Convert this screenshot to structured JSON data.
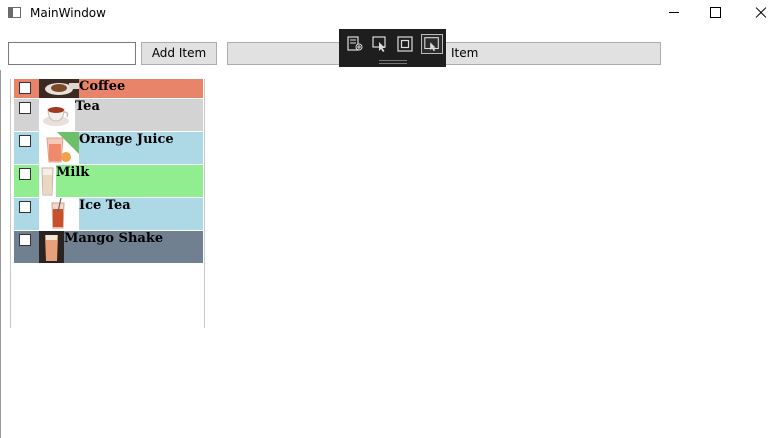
{
  "window": {
    "title": "MainWindow"
  },
  "toolbar": {
    "item_input_value": "",
    "add_label": "Add Item",
    "remove_label": "Item"
  },
  "colors": {
    "coffee": "#e8846a",
    "tea": "#d3d3d3",
    "orange_juice": "#add8e6",
    "milk": "#90ee90",
    "ice_tea": "#add8e6",
    "mango_shake": "#708090"
  },
  "list": {
    "items": [
      {
        "label": "Coffee",
        "checked": false,
        "icon": "coffee-cup-image"
      },
      {
        "label": "Tea",
        "checked": false,
        "icon": "tea-cup-image"
      },
      {
        "label": "Orange Juice",
        "checked": false,
        "icon": "orange-juice-image"
      },
      {
        "label": "Milk",
        "checked": false,
        "icon": "milk-glass-image"
      },
      {
        "label": "Ice Tea",
        "checked": false,
        "icon": "ice-tea-image"
      },
      {
        "label": "Mango Shake",
        "checked": false,
        "icon": "mango-shake-image"
      }
    ]
  }
}
